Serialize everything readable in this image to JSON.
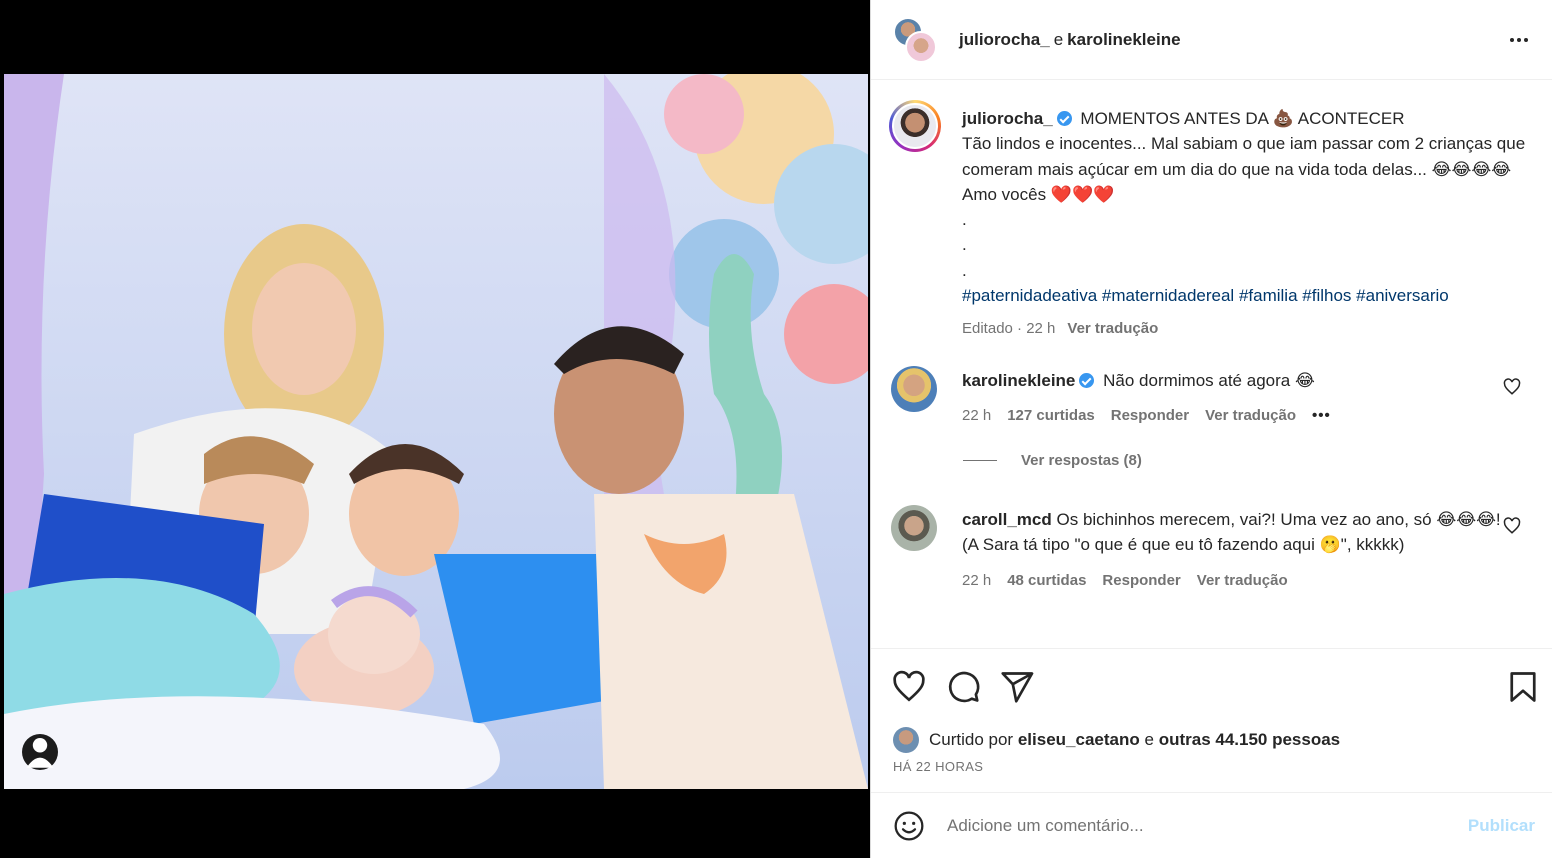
{
  "header": {
    "user1": "juliorocha_",
    "conj": "e",
    "user2": "karolinekleine",
    "more_icon": "more-horizontal-icon"
  },
  "caption": {
    "username": "juliorocha_",
    "line1": "MOMENTOS ANTES DA 💩  ACONTECER",
    "text": "Tão lindos e inocentes... Mal sabiam o que iam passar com 2 crianças que comeram mais açúcar em um dia do que na vida toda delas... 😂😂😂😂 Amo vocês ❤️❤️❤️",
    "dot1": ".",
    "dot2": ".",
    "dot3": ".",
    "hashtags": [
      "#paternidadeativa",
      "#maternidadereal",
      "#familia",
      "#filhos",
      "#aniversario"
    ],
    "edited": "Editado · 22 h",
    "translate": "Ver tradução"
  },
  "comments": [
    {
      "username": "karolinekleine",
      "verified": true,
      "text": "Não dormimos até agora 😂",
      "time": "22 h",
      "likes": "127 curtidas",
      "reply": "Responder",
      "translate": "Ver tradução",
      "more": "•••"
    },
    {
      "username": "caroll_mcd",
      "verified": false,
      "text": "Os bichinhos merecem, vai?! Uma vez ao ano, só 😂😂😂! (A Sara tá tipo \"o que é que eu tô fazendo aqui 🫢\", kkkkk)",
      "time": "22 h",
      "likes": "48 curtidas",
      "reply": "Responder",
      "translate": "Ver tradução"
    }
  ],
  "replies": {
    "label": "Ver respostas (8)"
  },
  "actions": {
    "icons": [
      "heart-icon",
      "comment-icon",
      "share-icon",
      "bookmark-icon"
    ]
  },
  "likes": {
    "prefix": "Curtido por",
    "user": "eliseu_caetano",
    "mid": "e",
    "others": "outras 44.150 pessoas"
  },
  "timestamp": "HÁ 22 HORAS",
  "add_comment": {
    "placeholder": "Adicione um comentário...",
    "publish": "Publicar"
  },
  "colors": {
    "link": "#00376b",
    "verified": "#3897f0",
    "muted": "#737373",
    "publish_disabled": "#b2dffc"
  }
}
